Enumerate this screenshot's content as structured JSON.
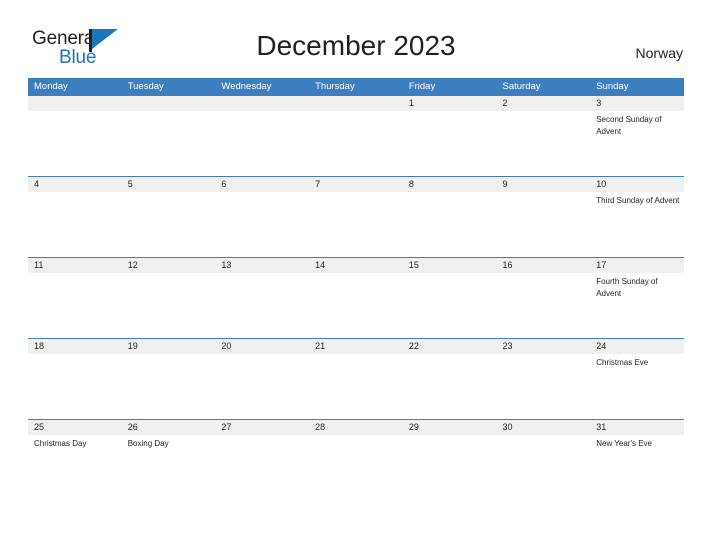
{
  "brand": {
    "name_part1": "General",
    "name_part2": "Blue",
    "flag_icon": "flag-icon"
  },
  "header": {
    "title": "December 2023",
    "country": "Norway"
  },
  "colors": {
    "header_blue": "#3c7ebf",
    "brand_blue": "#1c76bc",
    "date_band": "#f0f0f0",
    "text": "#231f20"
  },
  "calendar": {
    "month": "December",
    "year": "2023",
    "weekday_headers": [
      "Monday",
      "Tuesday",
      "Wednesday",
      "Thursday",
      "Friday",
      "Saturday",
      "Sunday"
    ],
    "weeks": [
      {
        "dates": [
          "",
          "",
          "",
          "",
          "1",
          "2",
          "3"
        ],
        "events": [
          [],
          [],
          [],
          [],
          [],
          [],
          [
            "Second Sunday of Advent"
          ]
        ]
      },
      {
        "dates": [
          "4",
          "5",
          "6",
          "7",
          "8",
          "9",
          "10"
        ],
        "events": [
          [],
          [],
          [],
          [],
          [],
          [],
          [
            "Third Sunday of Advent"
          ]
        ]
      },
      {
        "dates": [
          "11",
          "12",
          "13",
          "14",
          "15",
          "16",
          "17"
        ],
        "events": [
          [],
          [],
          [],
          [],
          [],
          [],
          [
            "Fourth Sunday of Advent"
          ]
        ]
      },
      {
        "dates": [
          "18",
          "19",
          "20",
          "21",
          "22",
          "23",
          "24"
        ],
        "events": [
          [],
          [],
          [],
          [],
          [],
          [],
          [
            "Christmas Eve"
          ]
        ]
      },
      {
        "dates": [
          "25",
          "26",
          "27",
          "28",
          "29",
          "30",
          "31"
        ],
        "events": [
          [
            "Christmas Day"
          ],
          [
            "Boxing Day"
          ],
          [],
          [],
          [],
          [],
          [
            "New Year's Eve"
          ]
        ]
      }
    ]
  }
}
